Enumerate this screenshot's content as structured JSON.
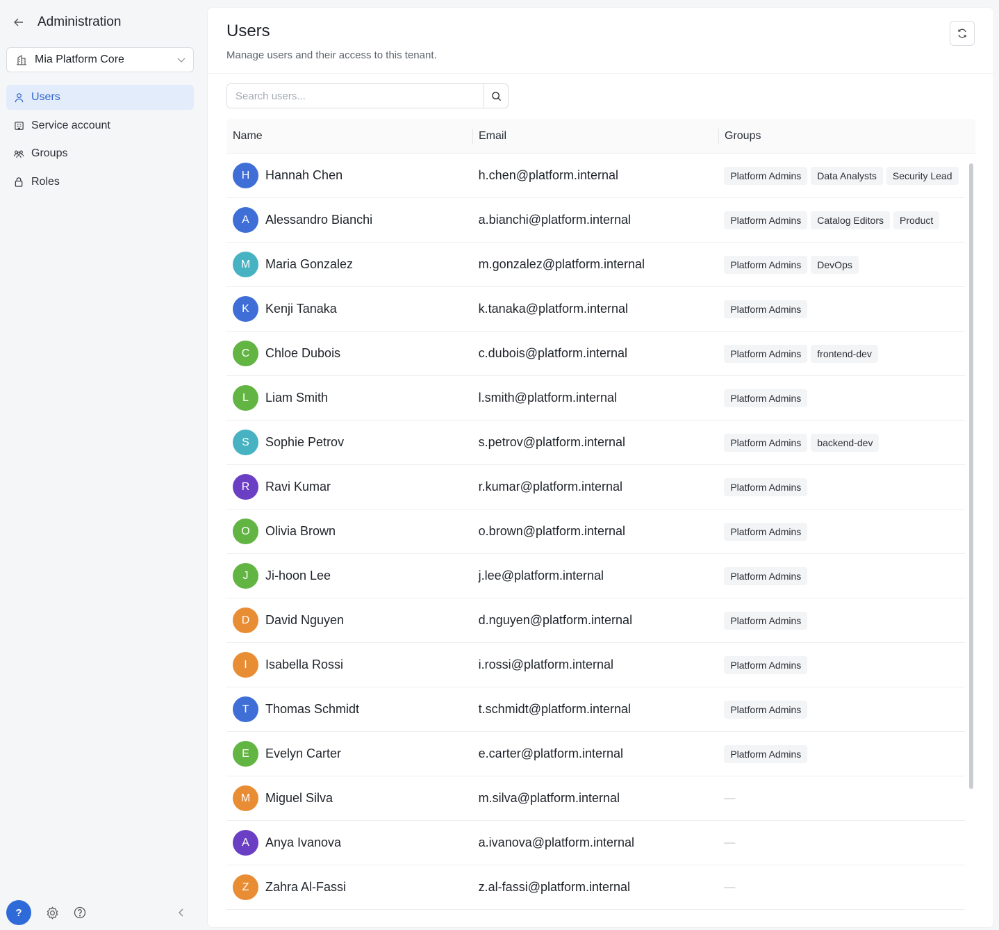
{
  "sidebar": {
    "title": "Administration",
    "tenant": "Mia Platform Core",
    "items": [
      {
        "label": "Users",
        "icon": "user-icon",
        "active": true
      },
      {
        "label": "Service account",
        "icon": "building-icon",
        "active": false
      },
      {
        "label": "Groups",
        "icon": "users-group-icon",
        "active": false
      },
      {
        "label": "Roles",
        "icon": "lock-icon",
        "active": false
      }
    ],
    "help_label": "?"
  },
  "main": {
    "title": "Users",
    "subtitle": "Manage users and their access to this tenant.",
    "search": {
      "placeholder": "Search users...",
      "value": ""
    },
    "columns": [
      "Name",
      "Email",
      "Groups"
    ],
    "empty_groups": "—",
    "rows": [
      {
        "initial": "H",
        "name": "Hannah Chen",
        "email": "h.chen@platform.internal",
        "color": "#3f6fd6",
        "groups": [
          "Platform Admins",
          "Data Analysts",
          "Security Lead"
        ]
      },
      {
        "initial": "A",
        "name": "Alessandro Bianchi",
        "email": "a.bianchi@platform.internal",
        "color": "#3f6fd6",
        "groups": [
          "Platform Admins",
          "Catalog Editors",
          "Product"
        ]
      },
      {
        "initial": "M",
        "name": "Maria Gonzalez",
        "email": "m.gonzalez@platform.internal",
        "color": "#47b3c2",
        "groups": [
          "Platform Admins",
          "DevOps"
        ]
      },
      {
        "initial": "K",
        "name": "Kenji Tanaka",
        "email": "k.tanaka@platform.internal",
        "color": "#3f6fd6",
        "groups": [
          "Platform Admins"
        ]
      },
      {
        "initial": "C",
        "name": "Chloe Dubois",
        "email": "c.dubois@platform.internal",
        "color": "#62b443",
        "groups": [
          "Platform Admins",
          "frontend-dev"
        ]
      },
      {
        "initial": "L",
        "name": "Liam Smith",
        "email": "l.smith@platform.internal",
        "color": "#62b443",
        "groups": [
          "Platform Admins"
        ]
      },
      {
        "initial": "S",
        "name": "Sophie Petrov",
        "email": "s.petrov@platform.internal",
        "color": "#47b3c2",
        "groups": [
          "Platform Admins",
          "backend-dev"
        ]
      },
      {
        "initial": "R",
        "name": "Ravi Kumar",
        "email": "r.kumar@platform.internal",
        "color": "#6b3fc4",
        "groups": [
          "Platform Admins"
        ]
      },
      {
        "initial": "O",
        "name": "Olivia Brown",
        "email": "o.brown@platform.internal",
        "color": "#62b443",
        "groups": [
          "Platform Admins"
        ]
      },
      {
        "initial": "J",
        "name": "Ji-hoon Lee",
        "email": "j.lee@platform.internal",
        "color": "#62b443",
        "groups": [
          "Platform Admins"
        ]
      },
      {
        "initial": "D",
        "name": "David Nguyen",
        "email": "d.nguyen@platform.internal",
        "color": "#e98d35",
        "groups": [
          "Platform Admins"
        ]
      },
      {
        "initial": "I",
        "name": "Isabella Rossi",
        "email": "i.rossi@platform.internal",
        "color": "#e98d35",
        "groups": [
          "Platform Admins"
        ]
      },
      {
        "initial": "T",
        "name": "Thomas Schmidt",
        "email": "t.schmidt@platform.internal",
        "color": "#3f6fd6",
        "groups": [
          "Platform Admins"
        ]
      },
      {
        "initial": "E",
        "name": "Evelyn Carter",
        "email": "e.carter@platform.internal",
        "color": "#62b443",
        "groups": [
          "Platform Admins"
        ]
      },
      {
        "initial": "M",
        "name": "Miguel Silva",
        "email": "m.silva@platform.internal",
        "color": "#e98d35",
        "groups": []
      },
      {
        "initial": "A",
        "name": "Anya Ivanova",
        "email": "a.ivanova@platform.internal",
        "color": "#6b3fc4",
        "groups": []
      },
      {
        "initial": "Z",
        "name": "Zahra Al-Fassi",
        "email": "z.al-fassi@platform.internal",
        "color": "#e98d35",
        "groups": []
      }
    ]
  }
}
